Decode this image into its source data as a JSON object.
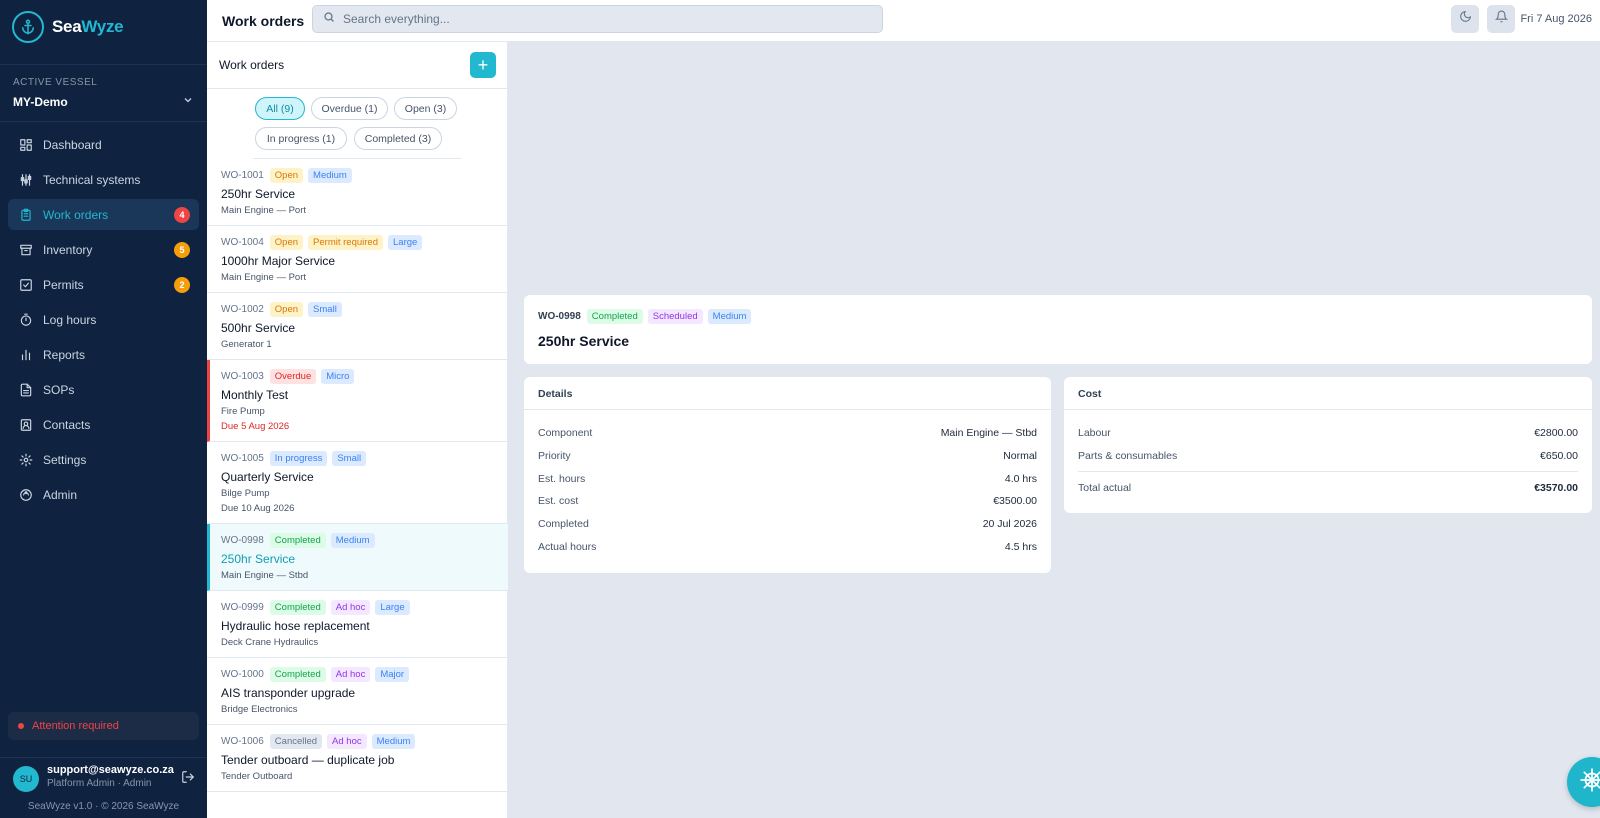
{
  "brand": {
    "name_a": "Sea",
    "name_b": "Wyze"
  },
  "vessel": {
    "label": "ACTIVE VESSEL",
    "name": "MY-Demo"
  },
  "nav": [
    {
      "label": "Dashboard",
      "icon": "dashboard-icon"
    },
    {
      "label": "Technical systems",
      "icon": "systems-icon"
    },
    {
      "label": "Work orders",
      "icon": "clipboard-icon",
      "badge": "4",
      "badge_color": "#ef4444"
    },
    {
      "label": "Inventory",
      "icon": "archive-icon",
      "badge": "5",
      "badge_color": "#f59e0b"
    },
    {
      "label": "Permits",
      "icon": "check-square-icon",
      "badge": "2",
      "badge_color": "#f59e0b"
    },
    {
      "label": "Log hours",
      "icon": "stopwatch-icon"
    },
    {
      "label": "Reports",
      "icon": "bar-chart-icon"
    },
    {
      "label": "SOPs",
      "icon": "document-icon"
    },
    {
      "label": "Contacts",
      "icon": "contacts-icon"
    },
    {
      "label": "Settings",
      "icon": "gear-icon"
    },
    {
      "label": "Admin",
      "icon": "admin-icon"
    }
  ],
  "attention": "Attention required",
  "user": {
    "initials": "SU",
    "email": "support@seawyze.co.za",
    "role": "Platform Admin · Admin"
  },
  "version": "SeaWyze v1.0 · © 2026 SeaWyze",
  "topbar": {
    "title": "Work orders",
    "search_placeholder": "Search everything...",
    "date": "Fri 7 Aug 2026"
  },
  "list": {
    "title": "Work orders",
    "add_label": "+",
    "filters": [
      "All (9)",
      "Overdue (1)",
      "Open (3)",
      "In progress (1)",
      "Completed (3)"
    ],
    "items": [
      {
        "id": "WO-1001",
        "tags": [
          [
            "Open",
            "t-open"
          ],
          [
            "Medium",
            "t-size"
          ]
        ],
        "name": "250hr Service",
        "sub": "Main Engine — Port"
      },
      {
        "id": "WO-1004",
        "tags": [
          [
            "Open",
            "t-open"
          ],
          [
            "Permit required",
            "t-permit"
          ],
          [
            "Large",
            "t-size"
          ]
        ],
        "name": "1000hr Major Service",
        "sub": "Main Engine — Port"
      },
      {
        "id": "WO-1002",
        "tags": [
          [
            "Open",
            "t-open"
          ],
          [
            "Small",
            "t-size"
          ]
        ],
        "name": "500hr Service",
        "sub": "Generator 1"
      },
      {
        "id": "WO-1003",
        "tags": [
          [
            "Overdue",
            "t-overdue"
          ],
          [
            "Micro",
            "t-size"
          ]
        ],
        "name": "Monthly Test",
        "sub": "Fire Pump",
        "due": "Due 5 Aug 2026"
      },
      {
        "id": "WO-1005",
        "tags": [
          [
            "In progress",
            "t-progress"
          ],
          [
            "Small",
            "t-size"
          ]
        ],
        "name": "Quarterly Service",
        "sub": "Bilge Pump",
        "due": "Due 10 Aug 2026"
      },
      {
        "id": "WO-0998",
        "tags": [
          [
            "Completed",
            "t-completed"
          ],
          [
            "Medium",
            "t-size"
          ]
        ],
        "name": "250hr Service",
        "sub": "Main Engine — Stbd"
      },
      {
        "id": "WO-0999",
        "tags": [
          [
            "Completed",
            "t-completed"
          ],
          [
            "Ad hoc",
            "t-adhoc"
          ],
          [
            "Large",
            "t-size"
          ]
        ],
        "name": "Hydraulic hose replacement",
        "sub": "Deck Crane Hydraulics"
      },
      {
        "id": "WO-1000",
        "tags": [
          [
            "Completed",
            "t-completed"
          ],
          [
            "Ad hoc",
            "t-adhoc"
          ],
          [
            "Major",
            "t-size"
          ]
        ],
        "name": "AIS transponder upgrade",
        "sub": "Bridge Electronics"
      },
      {
        "id": "WO-1006",
        "tags": [
          [
            "Cancelled",
            "t-cancel"
          ],
          [
            "Ad hoc",
            "t-adhoc"
          ],
          [
            "Medium",
            "t-size"
          ]
        ],
        "name": "Tender outboard — duplicate job",
        "sub": "Tender Outboard"
      }
    ]
  },
  "detail": {
    "id": "WO-0998",
    "tags": [
      [
        "Completed",
        "t-completed"
      ],
      [
        "Scheduled",
        "t-sched"
      ],
      [
        "Medium",
        "t-size"
      ]
    ],
    "title": "250hr Service",
    "details_title": "Details",
    "details": [
      [
        "Component",
        "Main Engine — Stbd"
      ],
      [
        "Priority",
        "Normal"
      ],
      [
        "Est. hours",
        "4.0 hrs"
      ],
      [
        "Est. cost",
        "€3500.00"
      ],
      [
        "Completed",
        "20 Jul 2026"
      ],
      [
        "Actual hours",
        "4.5 hrs"
      ]
    ],
    "cost_title": "Cost",
    "cost": [
      [
        "Labour",
        "€2800.00"
      ],
      [
        "Parts & consumables",
        "€650.00"
      ]
    ],
    "total": [
      "Total actual",
      "€3570.00"
    ]
  }
}
